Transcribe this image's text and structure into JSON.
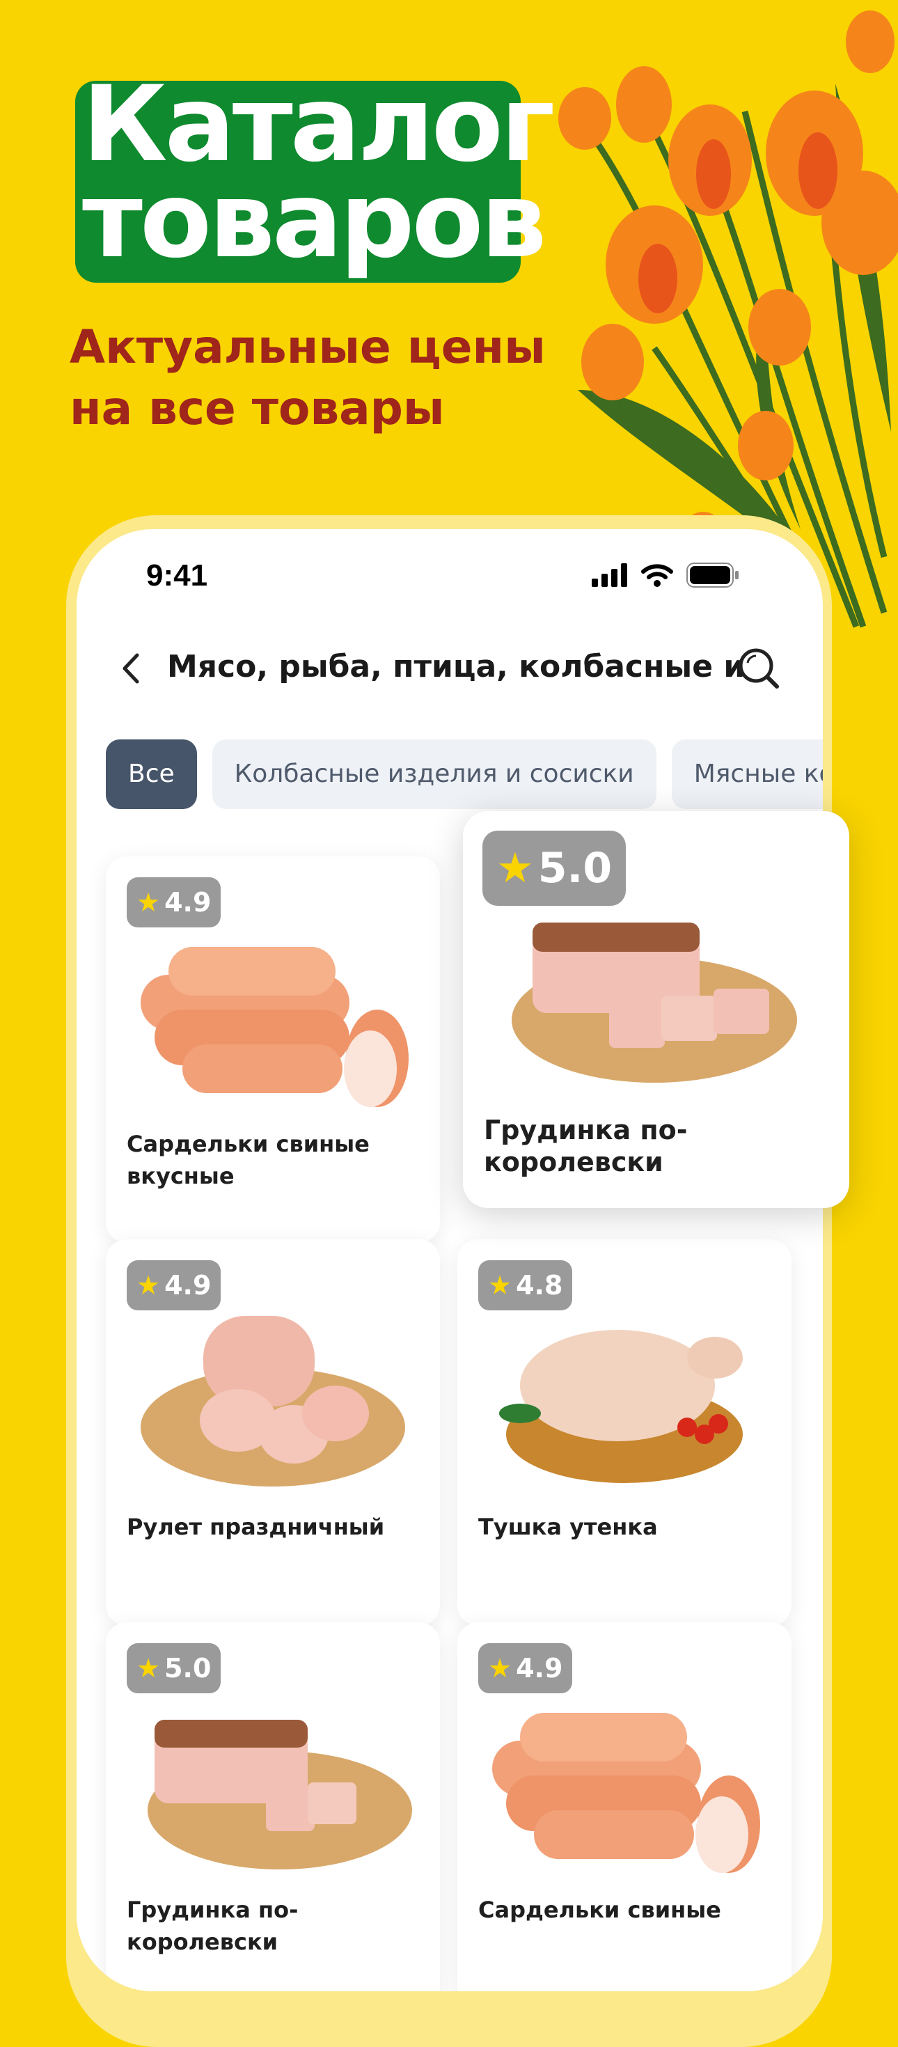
{
  "promo": {
    "title_line1": "Каталог",
    "title_line2": "товаров",
    "subtitle_line1": "Актуальные цены",
    "subtitle_line2": "на все товары"
  },
  "status_bar": {
    "time": "9:41"
  },
  "navbar": {
    "title": "Мясо, рыба, птица, колбасные и..."
  },
  "chips": [
    {
      "label": "Все",
      "active": true
    },
    {
      "label": "Колбасные изделия и сосиски",
      "active": false
    },
    {
      "label": "Мясные ко",
      "active": false
    }
  ],
  "products": [
    {
      "rating": "4.9",
      "name": "Сардельки свиные вкусные",
      "image": "sausages"
    },
    {
      "rating": "5.0",
      "name": "Грудинка по-королевски",
      "image": "brisket"
    },
    {
      "rating": "4.9",
      "name": "Рулет праздничный",
      "image": "roll"
    },
    {
      "rating": "4.8",
      "name": "Тушка утенка",
      "image": "duck"
    },
    {
      "rating": "5.0",
      "name": "Грудинка по-королевски",
      "image": "brisket"
    },
    {
      "rating": "4.9",
      "name": "Сардельки свиные",
      "image": "sausages"
    }
  ],
  "colors": {
    "background": "#F9D400",
    "title_bg": "#0F8A2E",
    "subtitle": "#A0251B",
    "chip_active": "#46556A"
  }
}
